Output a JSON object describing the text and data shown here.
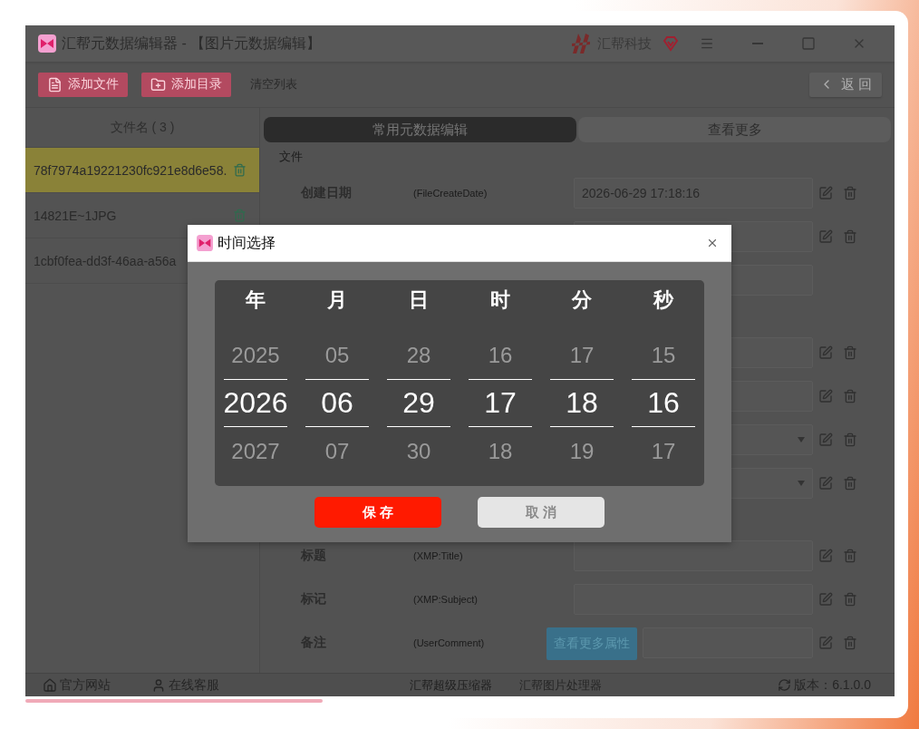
{
  "window": {
    "title": "汇帮元数据编辑器 - 【图片元数据编辑】",
    "brand": "汇帮科技"
  },
  "toolbar": {
    "buttons": [
      {
        "label": "添加文件",
        "kind": "file"
      },
      {
        "label": "添加目录",
        "kind": "folder"
      },
      {
        "label": "清空列表",
        "kind": "plain"
      }
    ],
    "back": "返 回"
  },
  "file_list": {
    "header": "文件名 ( 3 )",
    "items": [
      {
        "name": "78f7974a19221230fc921e8d6e58.",
        "selected": true,
        "trash": true
      },
      {
        "name": "14821E~1JPG",
        "selected": false,
        "trash": true
      },
      {
        "name": "1cbf0fea-dd3f-46aa-a56a",
        "selected": false,
        "trash": false
      }
    ]
  },
  "tabs": [
    {
      "label": "常用元数据编辑",
      "selected": true
    },
    {
      "label": "查看更多",
      "selected": false
    }
  ],
  "sections": [
    {
      "title": "文件",
      "rows": [
        {
          "label": "创建日期",
          "key": "(FileCreateDate)",
          "kind": "text",
          "value": "2026-06-29 17:18:16",
          "actions": true
        },
        {
          "kind": "text",
          "actions": true
        },
        {
          "kind": "text",
          "actions": false
        }
      ]
    },
    {
      "rows": [
        {
          "kind": "text",
          "actions": true
        },
        {
          "kind": "text",
          "actions": true
        },
        {
          "kind": "select",
          "actions": true
        },
        {
          "kind": "select",
          "actions": true
        }
      ]
    },
    {
      "rows": [
        {
          "label": "标题",
          "key": "(XMP:Title)",
          "kind": "text",
          "actions": true
        },
        {
          "label": "标记",
          "key": "(XMP:Subject)",
          "kind": "text",
          "actions": true
        },
        {
          "label": "备注",
          "key": "(UserComment)",
          "kind": "text",
          "actions": true
        }
      ]
    }
  ],
  "more_button": "查看更多属性",
  "footer": {
    "website": "官方网站",
    "support": "在线客服",
    "links": [
      "汇帮超级压缩器",
      "汇帮图片处理器"
    ],
    "version": "版本：6.1.0.0"
  },
  "dialog": {
    "title": "时间选择",
    "columns": [
      {
        "title": "年",
        "items": [
          {
            "text": "2025",
            "selected": false
          },
          {
            "text": "2026",
            "selected": true
          },
          {
            "text": "2027",
            "selected": false
          }
        ]
      },
      {
        "title": "月",
        "items": [
          {
            "text": "05",
            "selected": false
          },
          {
            "text": "06",
            "selected": true
          },
          {
            "text": "07",
            "selected": false
          }
        ]
      },
      {
        "title": "日",
        "items": [
          {
            "text": "28",
            "selected": false
          },
          {
            "text": "29",
            "selected": true
          },
          {
            "text": "30",
            "selected": false
          }
        ]
      },
      {
        "title": "时",
        "items": [
          {
            "text": "16",
            "selected": false
          },
          {
            "text": "17",
            "selected": true
          },
          {
            "text": "18",
            "selected": false
          }
        ]
      },
      {
        "title": "分",
        "items": [
          {
            "text": "17",
            "selected": false
          },
          {
            "text": "18",
            "selected": true
          },
          {
            "text": "19",
            "selected": false
          }
        ]
      },
      {
        "title": "秒",
        "items": [
          {
            "text": "15",
            "selected": false
          },
          {
            "text": "16",
            "selected": true
          },
          {
            "text": "17",
            "selected": false
          }
        ]
      }
    ],
    "save": "保 存",
    "cancel": "取 消"
  }
}
